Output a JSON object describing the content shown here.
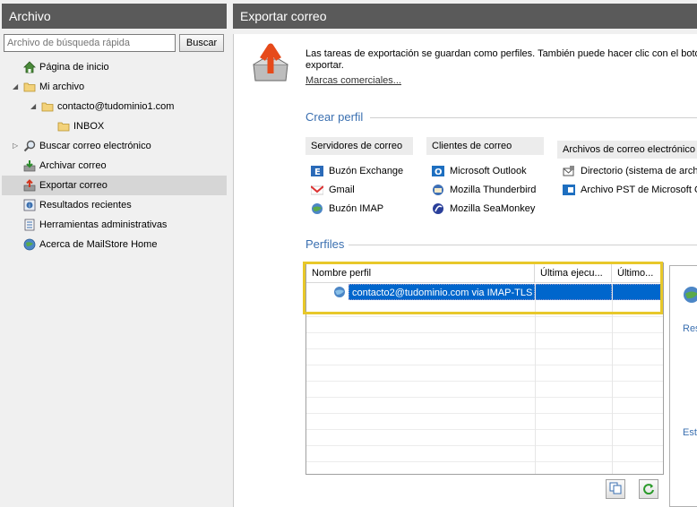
{
  "left": {
    "title": "Archivo",
    "search": {
      "placeholder": "Archivo de búsqueda rápida",
      "button": "Buscar"
    },
    "tree": [
      {
        "label": "Página de inicio",
        "icon": "home-icon"
      },
      {
        "label": "Mi archivo",
        "icon": "folder-icon",
        "expanded": true
      },
      {
        "label": "contacto@tudominio1.com",
        "icon": "folder-icon",
        "expanded": true
      },
      {
        "label": "INBOX",
        "icon": "folder-icon"
      },
      {
        "label": "Buscar correo electrónico",
        "icon": "magnifier-icon",
        "collapsed": true
      },
      {
        "label": "Archivar correo",
        "icon": "archive-mail-icon"
      },
      {
        "label": "Exportar correo",
        "icon": "export-mail-icon",
        "selected": true
      },
      {
        "label": "Resultados recientes",
        "icon": "recent-results-icon"
      },
      {
        "label": "Herramientas administrativas",
        "icon": "admin-tools-icon"
      },
      {
        "label": "Acerca de MailStore Home",
        "icon": "globe-info-icon"
      }
    ]
  },
  "right": {
    "title": "Exportar correo",
    "intro_line1": "Las tareas de exportación se guardan como perfiles. También puede hacer clic con el botón",
    "intro_line2": "exportar.",
    "trademarks_link": "Marcas comerciales...",
    "create_profile_title": "Crear perfil",
    "groups": [
      {
        "header": "Servidores de correo",
        "items": [
          "Buzón Exchange",
          "Gmail",
          "Buzón IMAP"
        ]
      },
      {
        "header": "Clientes de correo",
        "items": [
          "Microsoft Outlook",
          "Mozilla Thunderbird",
          "Mozilla SeaMonkey"
        ]
      },
      {
        "header": "Archivos de correo electrónico",
        "items": [
          "Directorio (sistema de archi",
          "Archivo PST de Microsoft O"
        ]
      }
    ],
    "profiles_title": "Perfiles",
    "table": {
      "columns": [
        "Nombre perfil",
        "Última ejecu...",
        "Último..."
      ],
      "rows": [
        {
          "name": "contacto2@tudominio.com via IMAP-TLS",
          "last_run": "",
          "last": ""
        }
      ]
    },
    "side_labels": [
      "Res",
      "Esta"
    ]
  },
  "colors": {
    "accent": "#3a6fb0",
    "selection": "#0066cc",
    "highlight": "#e8c82a"
  }
}
